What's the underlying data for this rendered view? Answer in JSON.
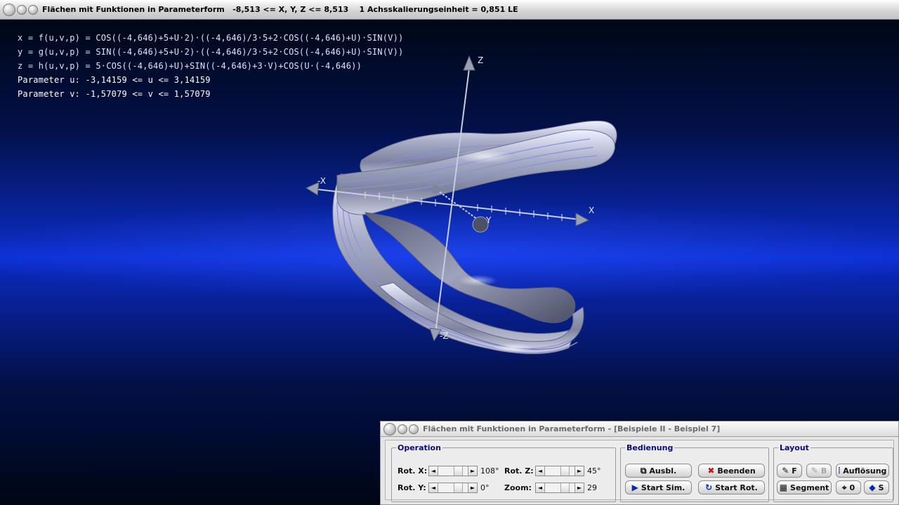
{
  "window": {
    "title": "Flächen mit Funktionen in Parameterform   -8,513 <= X, Y, Z <= 8,513    1 Achsskalierungseinheit = 0,851 LE"
  },
  "overlay": {
    "formula_x": "x = f(u,v,p) = COS((-4,646)+5+U·2)·((-4,646)/3·5+2·COS((-4,646)+U)·SIN(V))",
    "formula_y": "y = g(u,v,p) = SIN((-4,646)+5+U·2)·((-4,646)/3·5+2·COS((-4,646)+U)·SIN(V))",
    "formula_z": "z = h(u,v,p) = 5·COS((-4,646)+U)+SIN((-4,646)+3·V)+COS(U·(-4,646))",
    "param_u": "Parameter u: -3,14159 <= u <= 3,14159",
    "param_v": "Parameter v: -1,57079 <= v <= 1,57079"
  },
  "axes": {
    "z": "Z",
    "neg_z": "-Z",
    "x": "X",
    "neg_x": "-X",
    "y": "Y"
  },
  "panel": {
    "title": "Flächen mit Funktionen in Parameterform - [Beispiele II - Beispiel 7]",
    "operation": {
      "legend": "Operation",
      "rot_x_label": "Rot. X:",
      "rot_x_value": "108°",
      "rot_y_label": "Rot. Y:",
      "rot_y_value": "0°",
      "rot_z_label": "Rot. Z:",
      "rot_z_value": "45°",
      "zoom_label": "Zoom:",
      "zoom_value": "29"
    },
    "bedienung": {
      "legend": "Bedienung",
      "ausbl": "Ausbl.",
      "beenden": "Beenden",
      "start_sim": "Start Sim.",
      "start_rot": "Start Rot."
    },
    "layout": {
      "legend": "Layout",
      "f": "F",
      "b": "B",
      "aufloesung": "Auflösung",
      "segment": "Segment",
      "zero": "0",
      "s": "S"
    }
  }
}
